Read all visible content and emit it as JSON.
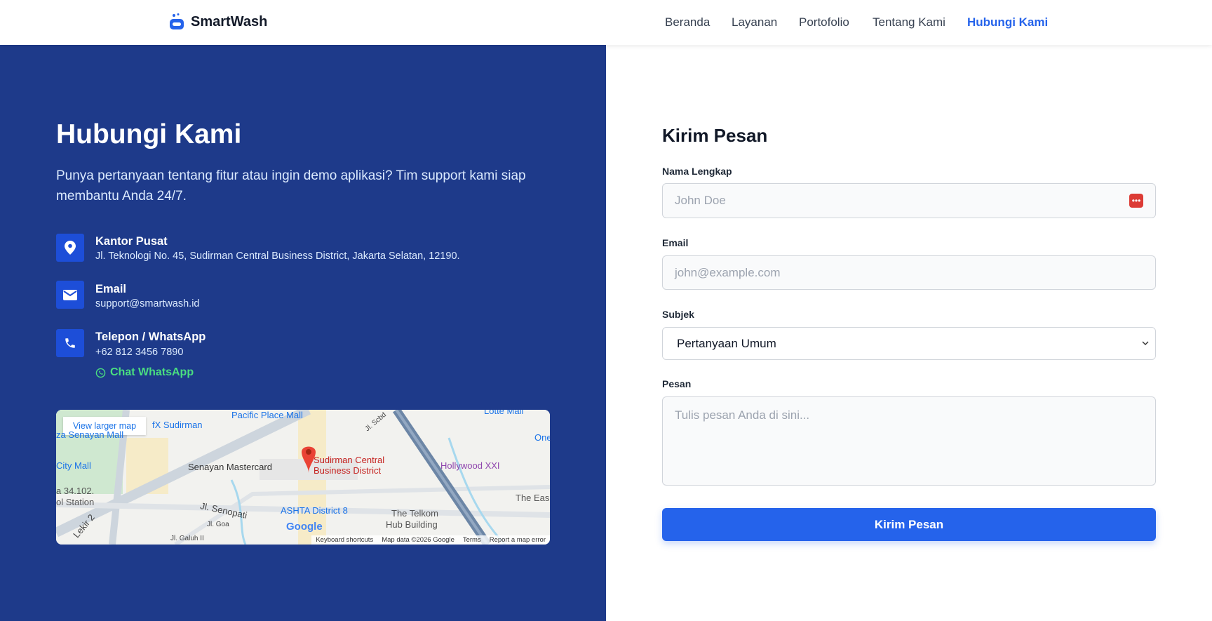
{
  "header": {
    "brand": "SmartWash",
    "nav": [
      {
        "label": "Beranda"
      },
      {
        "label": "Layanan"
      },
      {
        "label": "Portofolio"
      },
      {
        "label": "Tentang Kami"
      },
      {
        "label": "Hubungi Kami",
        "active": true
      }
    ]
  },
  "contact": {
    "title": "Hubungi Kami",
    "lead": "Punya pertanyaan tentang fitur atau ingin demo aplikasi? Tim support kami siap membantu Anda 24/7.",
    "items": [
      {
        "icon": "map-pin-icon",
        "title": "Kantor Pusat",
        "value": "Jl. Teknologi No. 45, Sudirman Central Business District, Jakarta Selatan, 12190."
      },
      {
        "icon": "envelope-icon",
        "title": "Email",
        "value": "support@smartwash.id"
      },
      {
        "icon": "phone-icon",
        "title": "Telepon / WhatsApp",
        "value": "+62 812 3456 7890"
      }
    ],
    "whatsapp_link": "Chat WhatsApp"
  },
  "map": {
    "view_larger": "View larger map",
    "marker": "Sudirman Central",
    "marker2": "Business District",
    "places": [
      "Pacific Place Mall",
      "fX Sudirman",
      "za Senayan Mall",
      "City Mall",
      "Senayan Mastercard",
      "Hollywood XXI",
      "ASHTA District 8",
      "The Telkom",
      "Hub Building",
      "a 34.102.",
      "ol Station",
      "Jl. Senopati",
      "Jl. Goa",
      "Jl. Galuh II",
      "Jl. Scbd",
      "The Eas",
      "Lotte Mall",
      "One",
      "Lekir 2"
    ],
    "footer": {
      "shortcuts": "Keyboard shortcuts",
      "data": "Map data ©2026 Google",
      "terms": "Terms",
      "report": "Report a map error"
    },
    "google": "Google"
  },
  "form": {
    "title": "Kirim Pesan",
    "name_label": "Nama Lengkap",
    "name_placeholder": "John Doe",
    "email_label": "Email",
    "email_placeholder": "john@example.com",
    "subject_label": "Subjek",
    "subject_value": "Pertanyaan Umum",
    "message_label": "Pesan",
    "message_placeholder": "Tulis pesan Anda di sini...",
    "submit": "Kirim Pesan"
  },
  "colors": {
    "primary": "#2563eb",
    "panel": "#1e3a8a",
    "whatsapp": "#4ade80"
  }
}
